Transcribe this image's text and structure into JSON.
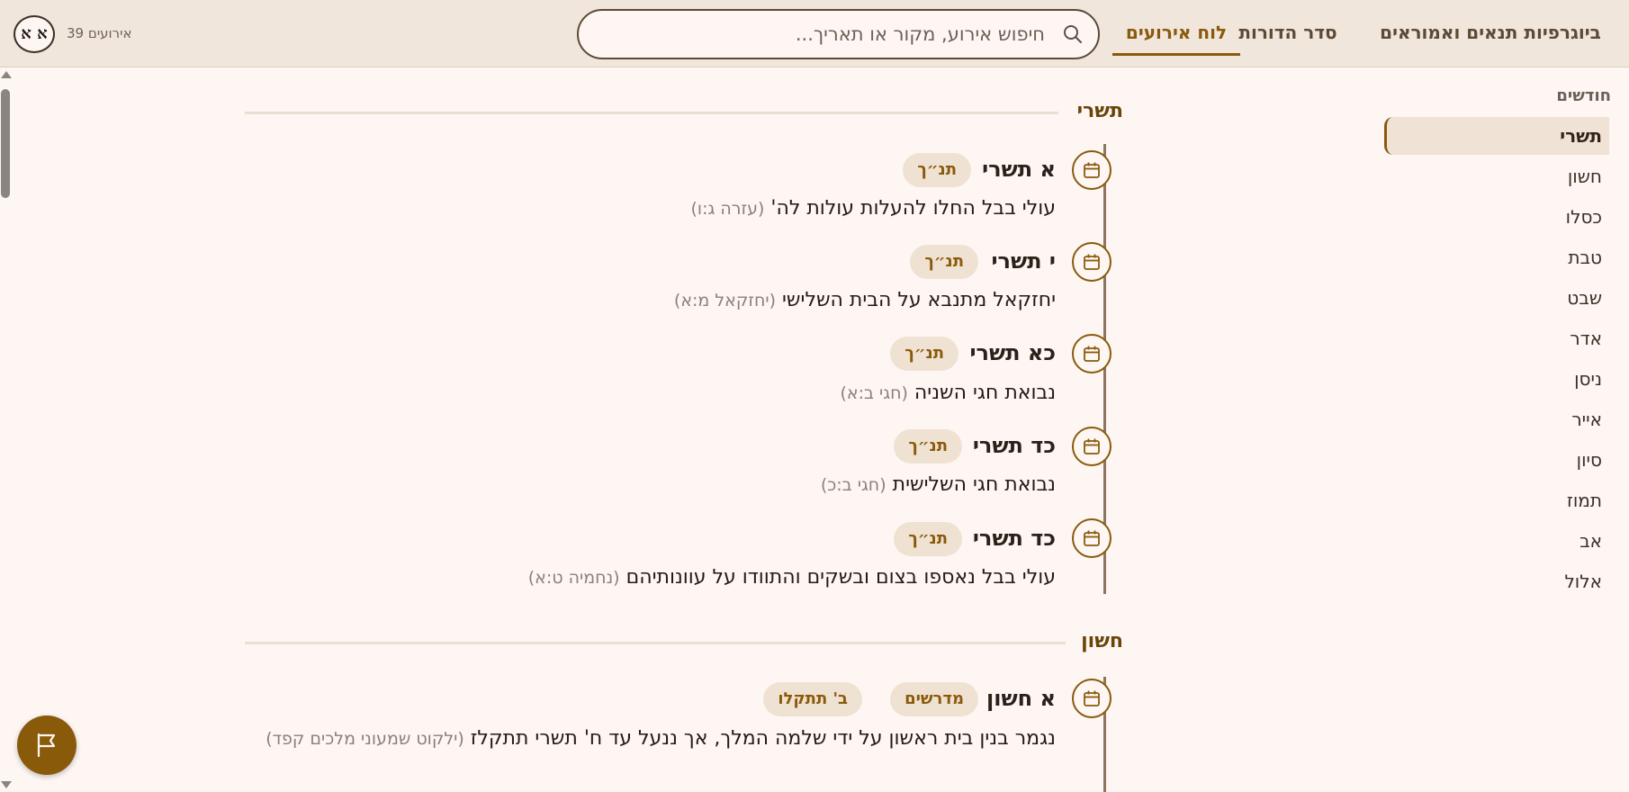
{
  "header": {
    "tabs": [
      {
        "label": "ביוגרפיות תנאים ואמוראים",
        "active": false
      },
      {
        "label": "סדר הדורות",
        "active": false
      },
      {
        "label": "לוח אירועים",
        "active": true
      }
    ],
    "search": {
      "placeholder": "חיפוש אירוע, מקור או תאריך...",
      "value": ""
    },
    "count_text": "39 אירועים",
    "font_toggle_label": "א א"
  },
  "sidebar": {
    "title": "חודשים",
    "months": [
      "תשרי",
      "חשון",
      "כסלו",
      "טבת",
      "שבט",
      "אדר",
      "ניסן",
      "אייר",
      "סיון",
      "תמוז",
      "אב",
      "אלול"
    ],
    "active_month": "תשרי"
  },
  "sections": [
    {
      "title": "תשרי",
      "events": [
        {
          "date": "א תשרי",
          "tags": [
            "תנ״ך"
          ],
          "description": "עולי בבל החלו להעלות עולות לה'",
          "source": "(עזרה ג:ו)"
        },
        {
          "date": "י תשרי",
          "tags": [
            "תנ״ך"
          ],
          "description": "יחזקאל מתנבא על הבית השלישי",
          "source": "(יחזקאל מ:א)"
        },
        {
          "date": "כא תשרי",
          "tags": [
            "תנ״ך"
          ],
          "description": "נבואת חגי השניה",
          "source": "(חגי ב:א)"
        },
        {
          "date": "כד תשרי",
          "tags": [
            "תנ״ך"
          ],
          "description": "נבואת חגי השלישית",
          "source": "(חגי ב:כ)"
        },
        {
          "date": "כד תשרי",
          "tags": [
            "תנ״ך"
          ],
          "description": "עולי בבל נאספו בצום ובשקים והתוודו על עוונותיהם",
          "source": "(נחמיה ט:א)"
        }
      ]
    },
    {
      "title": "חשון",
      "events": [
        {
          "date": "א חשון",
          "tags": [
            "מדרשים",
            "ב' תתקלו"
          ],
          "description": "נגמר בנין בית ראשון על ידי שלמה המלך, אך ננעל עד ח' תשרי תתקלז",
          "source": "(ילקוט שמעוני מלכים קפד)"
        }
      ]
    }
  ],
  "colors": {
    "accent": "#8a5a0b",
    "background": "#fdf6f3",
    "topbar": "#f1e6dc",
    "tag_bg": "#f0e2d2"
  },
  "icons": {
    "search": "search-icon",
    "calendar": "calendar-icon",
    "flag": "flag-icon"
  }
}
